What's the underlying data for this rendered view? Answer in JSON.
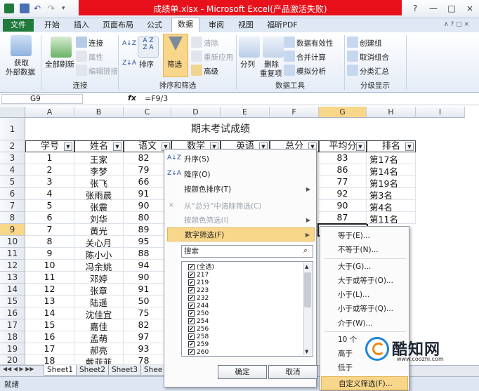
{
  "window": {
    "title": "成绩单.xlsx - Microsoft Excel(产品激活失败)",
    "controls": [
      "?",
      "—",
      "□",
      "×"
    ]
  },
  "ribbon": {
    "tabs": [
      "文件",
      "开始",
      "插入",
      "页面布局",
      "公式",
      "数据",
      "审阅",
      "视图",
      "福昕PDF"
    ],
    "active_tab": "数据",
    "get_external_data": [
      "获取",
      "外部数据"
    ],
    "connections": {
      "refresh_all": "全部刷新",
      "items": [
        "连接",
        "属性",
        "编辑链接"
      ],
      "label": "连接"
    },
    "sort_filter": {
      "sort": "排序",
      "filter": "筛选",
      "items": [
        "清除",
        "重新应用",
        "高级"
      ],
      "label": "排序和筛选"
    },
    "data_tools": {
      "split": "分列",
      "remove_dup": [
        "删除",
        "重复项"
      ],
      "items": [
        "数据有效性",
        "合并计算",
        "模拟分析"
      ],
      "label": "数据工具"
    },
    "outline": {
      "items": [
        "创建组",
        "取消组合",
        "分类汇总"
      ],
      "label": "分级显示"
    }
  },
  "formula_bar": {
    "name_box": "G9",
    "fx": "fx",
    "formula": "=F9/3"
  },
  "grid": {
    "columns": [
      "A",
      "B",
      "C",
      "D",
      "E",
      "F",
      "G",
      "H",
      "I"
    ],
    "selected_column": "G",
    "rows": [
      "1",
      "2",
      "3",
      "4",
      "5",
      "6",
      "7",
      "8",
      "9",
      "10",
      "11",
      "12",
      "13",
      "14",
      "15",
      "16",
      "17",
      "18"
    ],
    "selected_row": "9",
    "title": "期末考试成绩",
    "headers": [
      "学号",
      "姓名",
      "语文",
      "数学",
      "英语",
      "总分",
      "平均分",
      "排名"
    ],
    "ids": [
      "1",
      "2",
      "3",
      "4",
      "5",
      "6",
      "7",
      "8",
      "9",
      "10",
      "11",
      "12",
      "13",
      "14",
      "15",
      "16",
      "17",
      "18"
    ],
    "names": [
      "王家",
      "李梦",
      "张飞",
      "张雨晨",
      "张震",
      "刘华",
      "黄光",
      "关心月",
      "陈小小",
      "冯余姚",
      "邓婷",
      "张章",
      "陆遥",
      "沈佳宜",
      "嘉佳",
      "孟萌",
      "郝亮",
      "戴菲菲"
    ],
    "chinese": [
      "82",
      "79",
      "66",
      "91",
      "90",
      "80",
      "89",
      "95",
      "88",
      "94",
      "90",
      "91",
      "50",
      "75",
      "82",
      "97",
      "93",
      "78"
    ],
    "average": [
      "83",
      "86",
      "77",
      "92",
      "90",
      "87"
    ],
    "rank": [
      "第17名",
      "第14名",
      "第19名",
      "第3名",
      "第4名",
      "第11名"
    ]
  },
  "sheets": [
    "Sheet1",
    "Sheet2",
    "Sheet3",
    "Shee"
  ],
  "status": "就绪",
  "filter_menu": {
    "items": [
      "升序(S)",
      "降序(O)",
      "按颜色排序(T)",
      "从“总分”中清除筛选(C)",
      "按颜色筛选(I)",
      "数字筛选(F)"
    ],
    "search_placeholder": "搜索",
    "values": [
      "(全选)",
      "217",
      "219",
      "223",
      "232",
      "244",
      "250",
      "254",
      "256",
      "258",
      "259",
      "260"
    ],
    "ok": "确定",
    "cancel": "取消"
  },
  "number_filter_submenu": [
    "等于(E)...",
    "不等于(N)...",
    "大于(G)...",
    "大于或等于(O)...",
    "小于(L)...",
    "小于或等于(Q)...",
    "介于(W)...",
    "10 个",
    "高于",
    "低于",
    "自定义筛选(F)..."
  ],
  "watermark": {
    "name": "酷知网",
    "url": "www.coozhi.com"
  },
  "colors": {
    "excel_green": "#1f7a3b",
    "title_red": "#e8111b",
    "highlight": "#f8d68a"
  }
}
